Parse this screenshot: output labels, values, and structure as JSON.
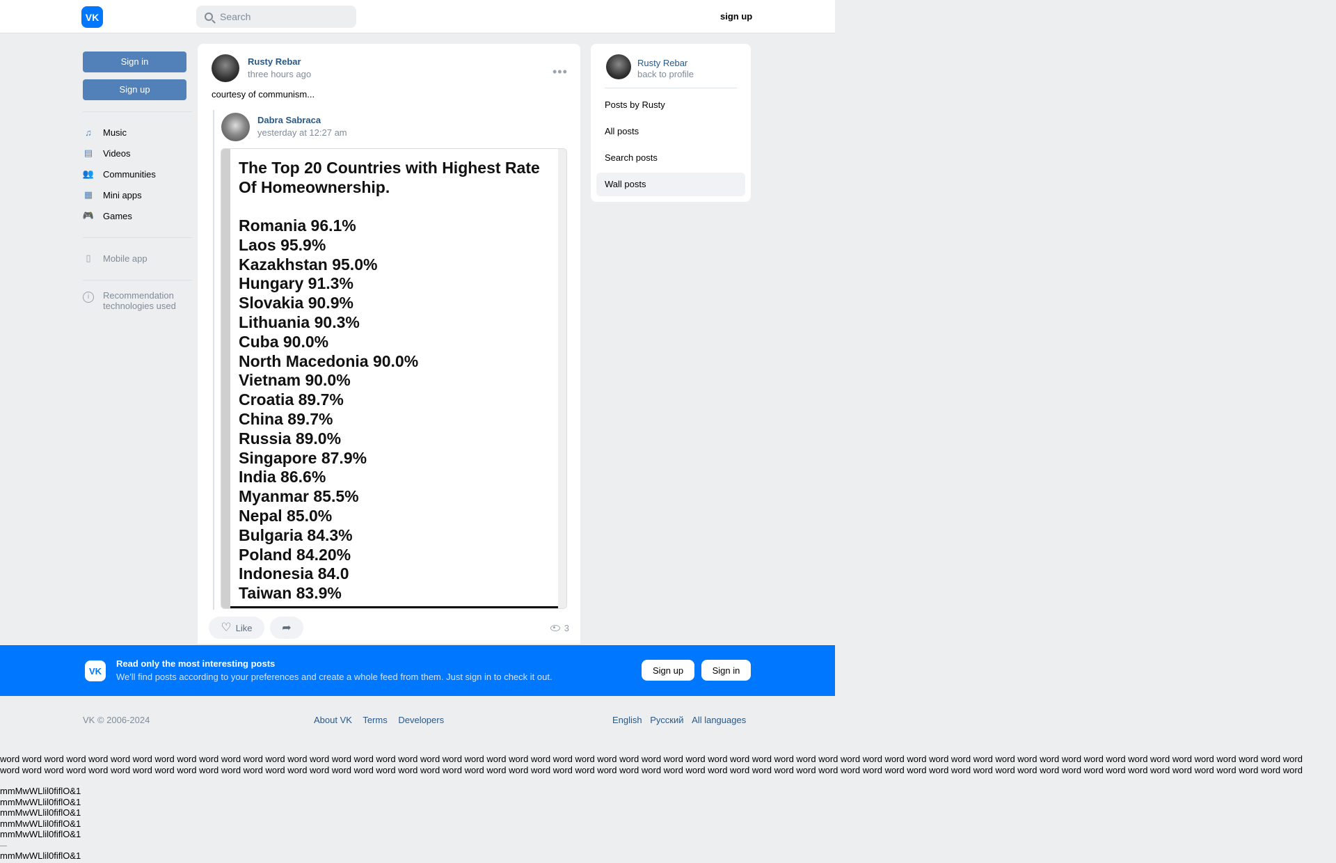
{
  "header": {
    "logo_text": "VK",
    "search_placeholder": "Search",
    "signup_label": "sign up"
  },
  "left_nav": {
    "signin_label": "Sign in",
    "signup_label": "Sign up",
    "items": [
      {
        "label": "Music",
        "icon": "music-note-icon"
      },
      {
        "label": "Videos",
        "icon": "video-icon"
      },
      {
        "label": "Communities",
        "icon": "users-icon"
      },
      {
        "label": "Mini apps",
        "icon": "grid-icon"
      },
      {
        "label": "Games",
        "icon": "gamepad-icon"
      }
    ],
    "mobile_app_label": "Mobile app",
    "recommendation_label_1": "Recommendation",
    "recommendation_label_2": "technologies used"
  },
  "post": {
    "author": "Rusty Rebar",
    "time": "three hours ago",
    "text": "courtesy of communism...",
    "repost": {
      "author": "Dabra Sabraca",
      "time": "yesterday at 12:27 am"
    },
    "photo": {
      "title": "The Top 20 Countries with Highest Rate Of Homeownership.",
      "lines": [
        "Romania 96.1%",
        "Laos 95.9%",
        "Kazakhstan 95.0%",
        "Hungary 91.3%",
        "Slovakia 90.9%",
        "Lithuania 90.3%",
        "Cuba 90.0%",
        "North Macedonia 90.0%",
        "Vietnam 90.0%",
        "Croatia 89.7%",
        "China 89.7%",
        "Russia 89.0%",
        "Singapore 87.9%",
        "India 86.6%",
        "Myanmar 85.5%",
        "Nepal 85.0%",
        "Bulgaria 84.3%",
        "Poland 84.20%",
        "Indonesia 84.0",
        "Taiwan 83.9%"
      ]
    },
    "like_label": "Like",
    "views": "3"
  },
  "right_panel": {
    "name": "Rusty Rebar",
    "back_label": "back to profile",
    "items": [
      "Posts by Rusty",
      "All posts",
      "Search posts",
      "Wall posts"
    ],
    "active_item": "Wall posts"
  },
  "banner": {
    "logo_text": "VK",
    "title": "Read only the most interesting posts",
    "subtitle": "We'll find posts according to your preferences and create a whole feed from them. Just sign in to check it out.",
    "signup_label": "Sign up",
    "signin_label": "Sign in"
  },
  "footer": {
    "copyright": "VK © 2006-2024",
    "links": [
      "About VK",
      "Terms",
      "Developers"
    ],
    "languages": [
      "English",
      "Русский",
      "All languages"
    ]
  },
  "test_text": {
    "word_line": "word word word word word word word word word word word word word word word word word word word word word word word word word word word word word word word word word word word word word word word word word word word word word word word word word word word word word word word word word word word",
    "glyph_line": "mmMwWLlil0fiflO&1"
  },
  "colors": {
    "accent": "#0077ff",
    "button": "#5181b8",
    "link": "#2a5885",
    "background": "#edeef0"
  }
}
